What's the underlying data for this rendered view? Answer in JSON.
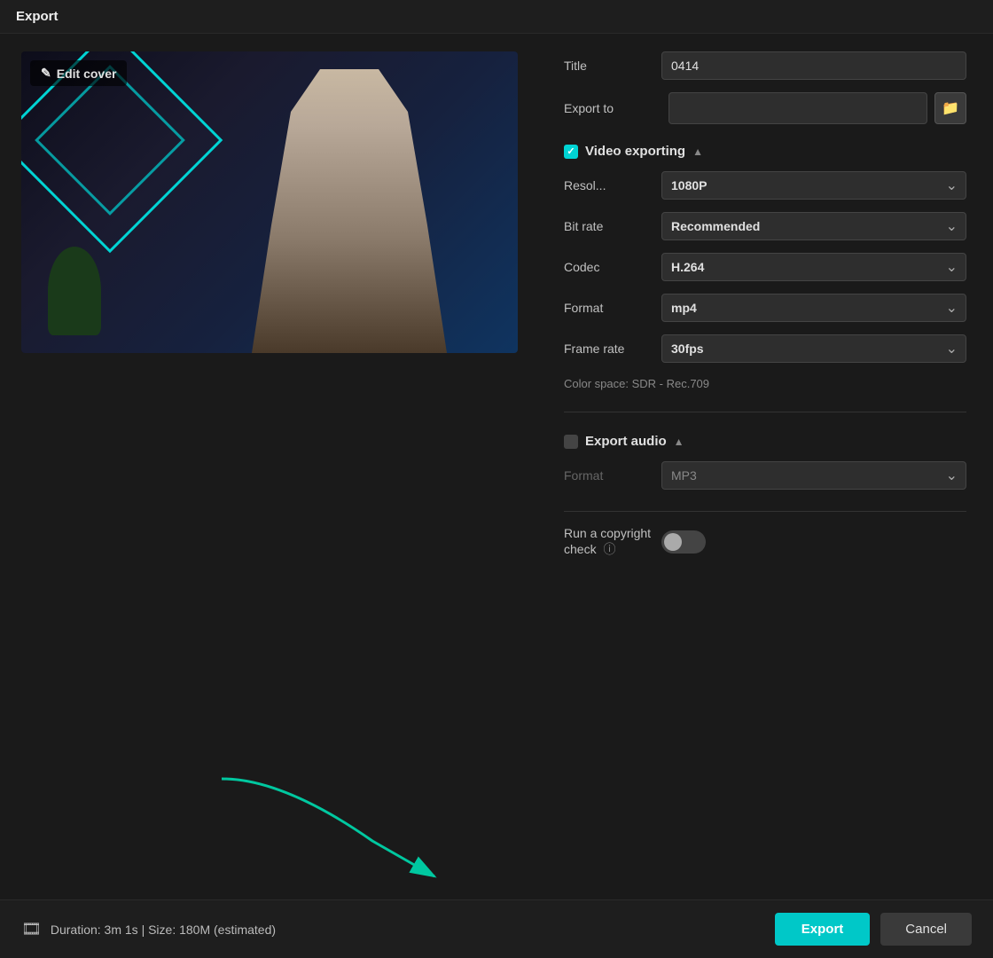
{
  "window": {
    "title": "Export"
  },
  "thumbnail": {
    "edit_cover_label": "Edit cover"
  },
  "settings": {
    "title_label": "Title",
    "title_value": "0414",
    "export_to_label": "Export to",
    "export_to_placeholder": "",
    "video_exporting_label": "Video exporting",
    "resolution_label": "Resol...",
    "resolution_value": "1080P",
    "bitrate_label": "Bit rate",
    "bitrate_value": "Recommended",
    "codec_label": "Codec",
    "codec_value": "H.264",
    "format_label": "Format",
    "format_value": "mp4",
    "framerate_label": "Frame rate",
    "framerate_value": "30fps",
    "color_space_label": "Color space: SDR - Rec.709",
    "export_audio_label": "Export audio",
    "audio_format_label": "Format",
    "audio_format_value": "MP3",
    "copyright_label": "Run a copyright check",
    "copyright_icon": "ⓘ"
  },
  "bottom": {
    "duration_text": "Duration: 3m 1s | Size: 180M (estimated)",
    "export_button": "Export",
    "cancel_button": "Cancel"
  },
  "icons": {
    "folder": "🗀",
    "film": "🎞",
    "pencil": "✎"
  }
}
